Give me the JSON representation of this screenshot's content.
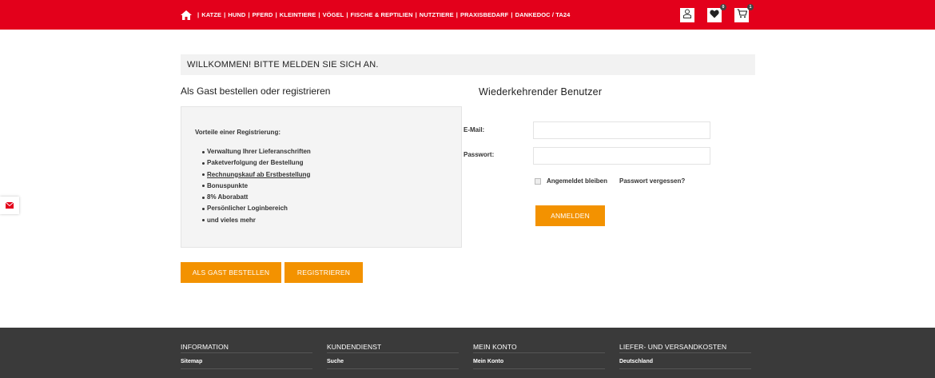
{
  "nav": {
    "items": [
      "KATZE",
      "HUND",
      "PFERD",
      "KLEINTIERE",
      "VÖGEL",
      "FISCHE & REPTILIEN",
      "NUTZTIERE",
      "PRAXISBEDARF",
      "DANKEDOC / TA24"
    ],
    "icons": {
      "home": "home-icon",
      "account": "user-icon",
      "wishlist": "heart-icon",
      "cart": "cart-icon",
      "mail": "mail-icon"
    },
    "wishlist_count": "0",
    "cart_count": "1"
  },
  "colors": {
    "brand": "#e3001b",
    "accent": "#f39200",
    "footer": "#3a3a3a"
  },
  "welcome": "WILLKOMMEN! BITTE MELDEN SIE SICH AN.",
  "guest": {
    "heading": "Als Gast bestellen oder registrieren",
    "benefits_title": "Vorteile einer Registrierung:",
    "benefits": [
      "Verwaltung Ihrer Lieferanschriften",
      "Paketverfolgung der Bestellung",
      "Rechnungskauf ab Erstbestellung",
      "Bonuspunkte",
      "8% Aborabatt",
      "Persönlicher Loginbereich",
      "und vieles mehr"
    ],
    "guest_button": "ALS GAST BESTELLEN",
    "register_button": "REGISTRIEREN"
  },
  "login": {
    "heading": "Wiederkehrender Benutzer",
    "email_label": "E-Mail:",
    "email_value": "",
    "password_label": "Passwort:",
    "password_value": "",
    "remember_label": "Angemeldet bleiben",
    "forgot_label": "Passwort vergessen?",
    "submit_button": "ANMELDEN"
  },
  "footer": {
    "columns": [
      {
        "title": "INFORMATION",
        "first": "Sitemap"
      },
      {
        "title": "KUNDENDIENST",
        "first": "Suche"
      },
      {
        "title": "MEIN KONTO",
        "first": "Mein Konto"
      },
      {
        "title": "LIEFER- UND VERSANDKOSTEN",
        "first": "Deutschland"
      }
    ]
  }
}
